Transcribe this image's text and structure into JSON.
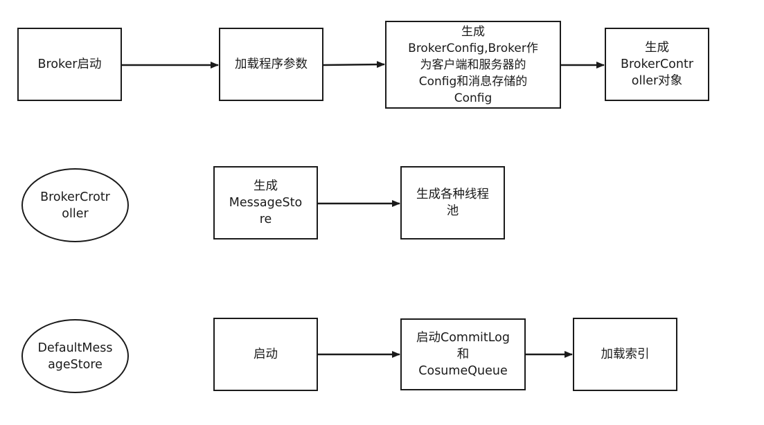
{
  "row1": {
    "broker_start": "Broker启动",
    "load_params": "加载程序参数",
    "gen_config": "生成\nBrokerConfig,Broker作\n为客户端和服务器的\nConfig和消息存储的\nConfig",
    "gen_controller": "生成\nBrokerContr\noller对象"
  },
  "row2": {
    "controller_label": "BrokerCrotr\noller",
    "gen_message_store": "生成\nMessageSto\nre",
    "gen_thread_pools": "生成各种线程\n池"
  },
  "row3": {
    "store_label": "DefaultMess\nageStore",
    "start": "启动",
    "start_commitlog": "启动CommitLog\n和\nCosumeQueue",
    "load_index": "加载索引"
  },
  "colors": {
    "stroke": "#1a1a1a",
    "fill": "#ffffff"
  }
}
